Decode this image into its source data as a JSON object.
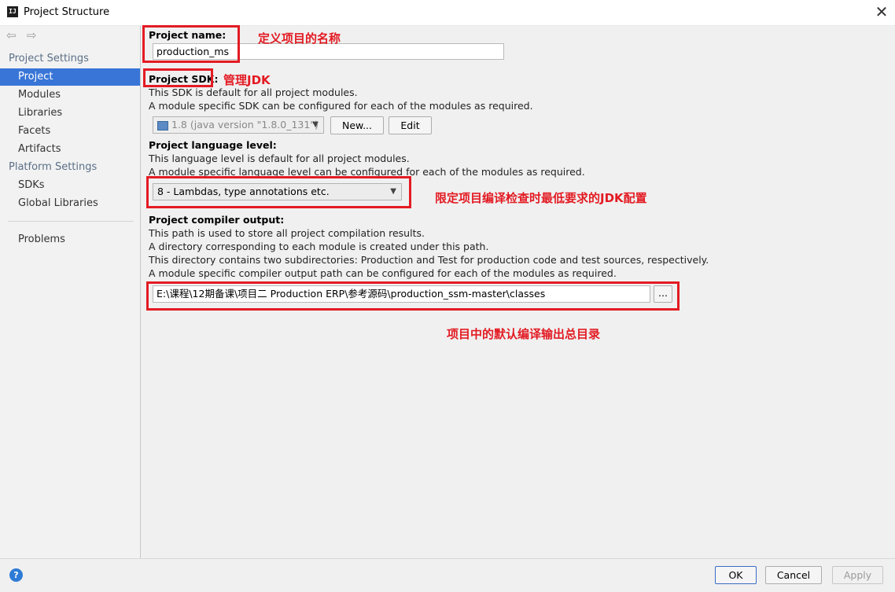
{
  "window": {
    "app_icon": "IJ",
    "title": "Project Structure",
    "close": "✕"
  },
  "nav": {
    "back": "⇦",
    "forward": "⇨"
  },
  "sidebar": {
    "project_settings_header": "Project Settings",
    "project_items": [
      "Project",
      "Modules",
      "Libraries",
      "Facets",
      "Artifacts"
    ],
    "platform_settings_header": "Platform Settings",
    "platform_items": [
      "SDKs",
      "Global Libraries"
    ],
    "problems": "Problems",
    "selected": "Project"
  },
  "project_name": {
    "label": "Project name:",
    "value": "production_ms"
  },
  "project_sdk": {
    "label": "Project SDK:",
    "desc1": "This SDK is default for all project modules.",
    "desc2": "A module specific SDK can be configured for each of the modules as required.",
    "selected": "1.8 (java version \"1.8.0_131\")",
    "new_button": "New...",
    "edit_button": "Edit"
  },
  "language_level": {
    "label": "Project language level:",
    "desc1": "This language level is default for all project modules.",
    "desc2": "A module specific language level can be configured for each of the modules as required.",
    "selected": "8 - Lambdas, type annotations etc."
  },
  "compiler_output": {
    "label": "Project compiler output:",
    "desc1": "This path is used to store all project compilation results.",
    "desc2": "A directory corresponding to each module is created under this path.",
    "desc3": "This directory contains two subdirectories: Production and Test for production code and test sources, respectively.",
    "desc4": "A module specific compiler output path can be configured for each of the modules as required.",
    "path": "E:\\课程\\12期备课\\项目二 Production ERP\\参考源码\\production_ssm-master\\classes",
    "browse_button": "..."
  },
  "annotations": {
    "name": "定义项目的名称",
    "sdk": "管理JDK",
    "language": "限定项目编译检查时最低要求的JDK配置",
    "output": "项目中的默认编译输出总目录"
  },
  "footer": {
    "help": "?",
    "ok": "OK",
    "cancel": "Cancel",
    "apply": "Apply"
  },
  "colors": {
    "selection": "#3875d7",
    "annotation_red": "#e31b23",
    "section_header": "#5a6f86"
  }
}
